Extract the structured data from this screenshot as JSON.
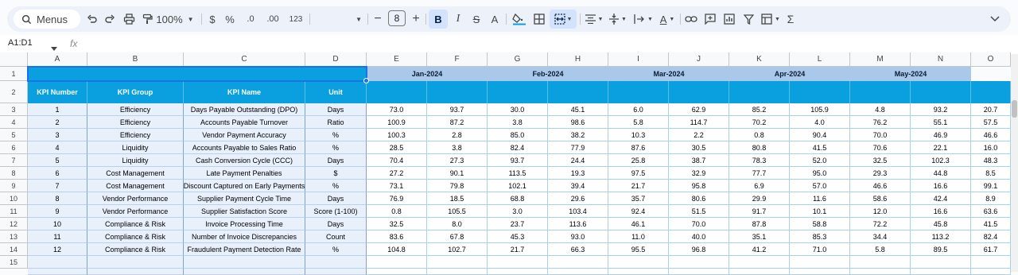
{
  "toolbar": {
    "menus_label": "Menus",
    "zoom": "100%",
    "currency": "$",
    "percent": "%",
    "decrease_decimals": ".0",
    "increase_decimals": ".00",
    "number_format": "123",
    "font_size": "8"
  },
  "formula_bar": {
    "name_box": "A1:D1",
    "fx": "fx"
  },
  "columns": [
    "A",
    "B",
    "C",
    "D",
    "E",
    "F",
    "G",
    "H",
    "I",
    "J",
    "K",
    "L",
    "M",
    "N",
    "O"
  ],
  "rows": [
    "1",
    "2",
    "3",
    "4",
    "5",
    "6",
    "7",
    "8",
    "9",
    "10",
    "11",
    "12",
    "13",
    "14",
    "15"
  ],
  "months": [
    "Jan-2024",
    "Feb-2024",
    "Mar-2024",
    "Apr-2024",
    "May-2024"
  ],
  "headers": {
    "kpi_number": "KPI Number",
    "kpi_group": "KPI Group",
    "kpi_name": "KPI Name",
    "unit": "Unit"
  },
  "kpis": [
    {
      "num": "1",
      "group": "Efficiency",
      "name": "Days Payable Outstanding (DPO)",
      "unit": "Days",
      "values": [
        "73.0",
        "93.7",
        "30.0",
        "45.1",
        "6.0",
        "62.9",
        "85.2",
        "105.9",
        "4.8",
        "93.2",
        "20.7"
      ]
    },
    {
      "num": "2",
      "group": "Efficiency",
      "name": "Accounts Payable Turnover",
      "unit": "Ratio",
      "values": [
        "100.9",
        "87.2",
        "3.8",
        "98.6",
        "5.8",
        "114.7",
        "70.2",
        "4.0",
        "76.2",
        "55.1",
        "57.5"
      ]
    },
    {
      "num": "3",
      "group": "Efficiency",
      "name": "Vendor Payment Accuracy",
      "unit": "%",
      "values": [
        "100.3",
        "2.8",
        "85.0",
        "38.2",
        "10.3",
        "2.2",
        "0.8",
        "90.4",
        "70.0",
        "46.9",
        "46.6"
      ]
    },
    {
      "num": "4",
      "group": "Liquidity",
      "name": "Accounts Payable to Sales Ratio",
      "unit": "%",
      "values": [
        "28.5",
        "3.8",
        "82.4",
        "77.9",
        "87.6",
        "30.5",
        "80.8",
        "41.5",
        "70.6",
        "22.1",
        "16.0"
      ]
    },
    {
      "num": "5",
      "group": "Liquidity",
      "name": "Cash Conversion Cycle (CCC)",
      "unit": "Days",
      "values": [
        "70.4",
        "27.3",
        "93.7",
        "24.4",
        "25.8",
        "38.7",
        "78.3",
        "52.0",
        "32.5",
        "102.3",
        "48.3"
      ]
    },
    {
      "num": "6",
      "group": "Cost Management",
      "name": "Late Payment Penalties",
      "unit": "$",
      "values": [
        "27.2",
        "90.1",
        "113.5",
        "19.3",
        "97.5",
        "32.9",
        "77.7",
        "95.0",
        "29.3",
        "44.8",
        "8.5"
      ]
    },
    {
      "num": "7",
      "group": "Cost Management",
      "name": "Discount Captured on Early Payments",
      "unit": "%",
      "values": [
        "73.1",
        "79.8",
        "102.1",
        "39.4",
        "21.7",
        "95.8",
        "6.9",
        "57.0",
        "46.6",
        "16.6",
        "99.1"
      ]
    },
    {
      "num": "8",
      "group": "Vendor Performance",
      "name": "Supplier Payment Cycle Time",
      "unit": "Days",
      "values": [
        "76.9",
        "18.5",
        "68.8",
        "29.6",
        "35.7",
        "80.6",
        "29.9",
        "11.6",
        "58.6",
        "42.4",
        "8.9"
      ]
    },
    {
      "num": "9",
      "group": "Vendor Performance",
      "name": "Supplier Satisfaction Score",
      "unit": "Score (1-100)",
      "values": [
        "0.8",
        "105.5",
        "3.0",
        "103.4",
        "92.4",
        "51.5",
        "91.7",
        "10.1",
        "12.0",
        "16.6",
        "63.6"
      ]
    },
    {
      "num": "10",
      "group": "Compliance & Risk",
      "name": "Invoice Processing Time",
      "unit": "Days",
      "values": [
        "32.5",
        "8.0",
        "23.7",
        "113.6",
        "46.1",
        "70.0",
        "87.8",
        "58.8",
        "72.2",
        "45.8",
        "41.5"
      ]
    },
    {
      "num": "11",
      "group": "Compliance & Risk",
      "name": "Number of Invoice Discrepancies",
      "unit": "Count",
      "values": [
        "83.6",
        "67.8",
        "45.3",
        "93.0",
        "11.0",
        "40.0",
        "35.1",
        "85.3",
        "34.4",
        "113.2",
        "82.4"
      ]
    },
    {
      "num": "12",
      "group": "Compliance & Risk",
      "name": "Fraudulent Payment Detection Rate",
      "unit": "%",
      "values": [
        "104.8",
        "102.7",
        "21.7",
        "66.3",
        "95.5",
        "96.8",
        "41.2",
        "71.0",
        "5.8",
        "89.5",
        "61.7"
      ]
    }
  ],
  "colors": {
    "header_blue": "#0aa0e0",
    "month_blue": "#a9c8ea",
    "kpi_fill": "#e8f0fb",
    "selection": "#1a73e8"
  }
}
